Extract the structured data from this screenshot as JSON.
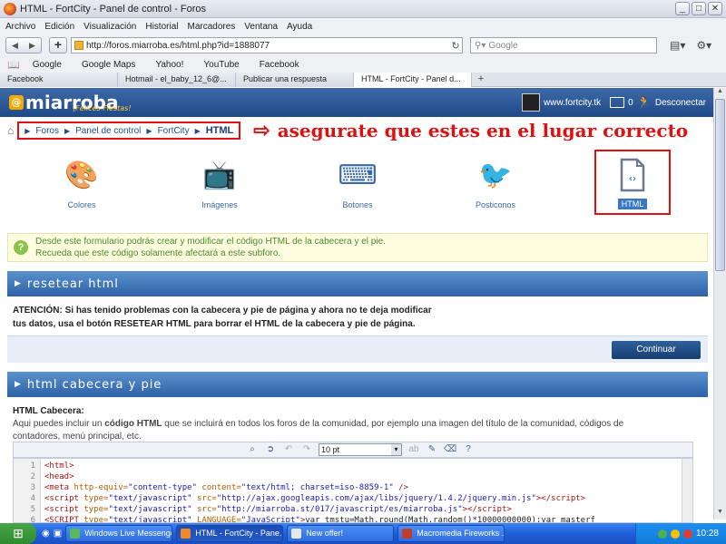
{
  "window": {
    "title": "HTML - FortCity - Panel de control - Foros"
  },
  "menu": [
    "Archivo",
    "Edición",
    "Visualización",
    "Historial",
    "Marcadores",
    "Ventana",
    "Ayuda"
  ],
  "nav": {
    "url": "http://foros.miarroba.es/html.php?id=1888077",
    "search_placeholder": "Google"
  },
  "bookmarks": [
    "Google",
    "Google Maps",
    "Yahoo!",
    "YouTube",
    "Facebook"
  ],
  "tabs": [
    {
      "label": "Facebook"
    },
    {
      "label": "Hotmail - el_baby_12_6@..."
    },
    {
      "label": "Publicar una respuesta"
    },
    {
      "label": "HTML - FortCity - Panel d..."
    }
  ],
  "site": {
    "logo": "miarroba",
    "tagline": "¡Felices Fiestas!",
    "link": "www.fortcity.tk",
    "mail_count": "0",
    "logout": "Desconectar"
  },
  "breadcrumb": [
    "Foros",
    "Panel de control",
    "FortCity",
    "HTML"
  ],
  "annotation": "asegurate que estes en el lugar correcto",
  "tools": [
    {
      "label": "Colores",
      "icon": "palette-icon"
    },
    {
      "label": "Imágenes",
      "icon": "tv-icon"
    },
    {
      "label": "Botones",
      "icon": "keyboard-icon"
    },
    {
      "label": "Posticonos",
      "icon": "bird-icon"
    },
    {
      "label": "HTML",
      "icon": "html-file-icon"
    }
  ],
  "info": {
    "line1": "Desde este formulario podrás crear y modificar el código HTML de la cabecera y el pie.",
    "line2": "Recueda que este código solamente afectará a este subforo."
  },
  "reset": {
    "heading": "resetear html",
    "text_bold": "ATENCIÓN",
    "text1": ": Si has tenido problemas con la cabecera y pie de página y ahora no te deja modificar",
    "text2": "tus datos, usa el botón RESETEAR HTML para borrar el HTML de la cabecera y pie de página.",
    "button": "Continuar"
  },
  "cabecera": {
    "heading": "html cabecera y pie",
    "label": "HTML Cabecera",
    "desc_a": "Aqui puedes incluir un ",
    "desc_bold": "código HTML",
    "desc_b": " que se incluirá en todos los foros de la comunidad, por ejemplo una imagen del título de la comunidad, códigos de",
    "desc_c": "contadores, menú principal, etc.",
    "font_size": "10 pt"
  },
  "code": [
    {
      "n": "1",
      "html": "<span class=\"tag\">&lt;html&gt;</span>"
    },
    {
      "n": "2",
      "html": "<span class=\"tag\">&lt;head&gt;</span>"
    },
    {
      "n": "3",
      "html": "<span class=\"tag\">&lt;meta</span> <span class=\"attr\">http-equiv=</span><span class=\"str\">\"content-type\"</span> <span class=\"attr\">content=</span><span class=\"str\">\"text/html; charset=iso-8859-1\"</span> <span class=\"tag\">/&gt;</span>"
    },
    {
      "n": "4",
      "html": "<span class=\"tag\">&lt;script</span> <span class=\"attr\">type=</span><span class=\"str\">\"text/javascript\"</span> <span class=\"attr\">src=</span><span class=\"str\">\"http://ajax.googleapis.com/ajax/libs/jquery/1.4.2/jquery.min.js\"</span><span class=\"tag\">&gt;&lt;/script&gt;</span>"
    },
    {
      "n": "5",
      "html": "<span class=\"tag\">&lt;script</span> <span class=\"attr\">type=</span><span class=\"str\">\"text/javascript\"</span> <span class=\"attr\">src=</span><span class=\"str\">\"http://miarroba.st/017/javascript/es/miarroba.js\"</span><span class=\"tag\">&gt;&lt;/script&gt;</span>"
    },
    {
      "n": "6",
      "html": "<span class=\"tag\">&lt;SCRIPT</span> <span class=\"attr\">type=</span><span class=\"str\">\"text/javascript\"</span> <span class=\"attr\">LANGUAGE=</span><span class=\"str\">\"JavaScript\"</span><span class=\"tag\">&gt;</span>var tmstu=Math.round(Math.random()*10000000000);var masterf"
    }
  ],
  "taskbar": {
    "tasks": [
      "Windows Live Messenger",
      "HTML - FortCity - Pane...",
      "New offer!",
      "Macromedia Fireworks ..."
    ],
    "clock": "10:28"
  }
}
